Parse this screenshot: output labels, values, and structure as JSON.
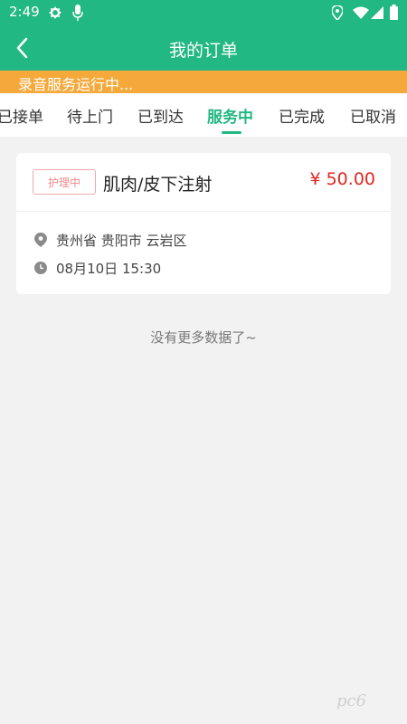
{
  "status_bar": {
    "time": "2:49"
  },
  "header": {
    "title": "我的订单"
  },
  "banner": {
    "text": "录音服务运行中..."
  },
  "tabs": [
    {
      "label": "已接单"
    },
    {
      "label": "待上门"
    },
    {
      "label": "已到达"
    },
    {
      "label": "服务中",
      "active": true
    },
    {
      "label": "已完成"
    },
    {
      "label": "已取消"
    }
  ],
  "order": {
    "status_tag": "护理中",
    "service": "肌肉/皮下注射",
    "price": "¥ 50.00",
    "address": "贵州省 贵阳市 云岩区",
    "time": "08月10日 15:30"
  },
  "footer_text": "没有更多数据了~",
  "watermark": "pc6",
  "colors": {
    "primary": "#22b883",
    "banner": "#f5a93b",
    "price": "#e0261f"
  }
}
